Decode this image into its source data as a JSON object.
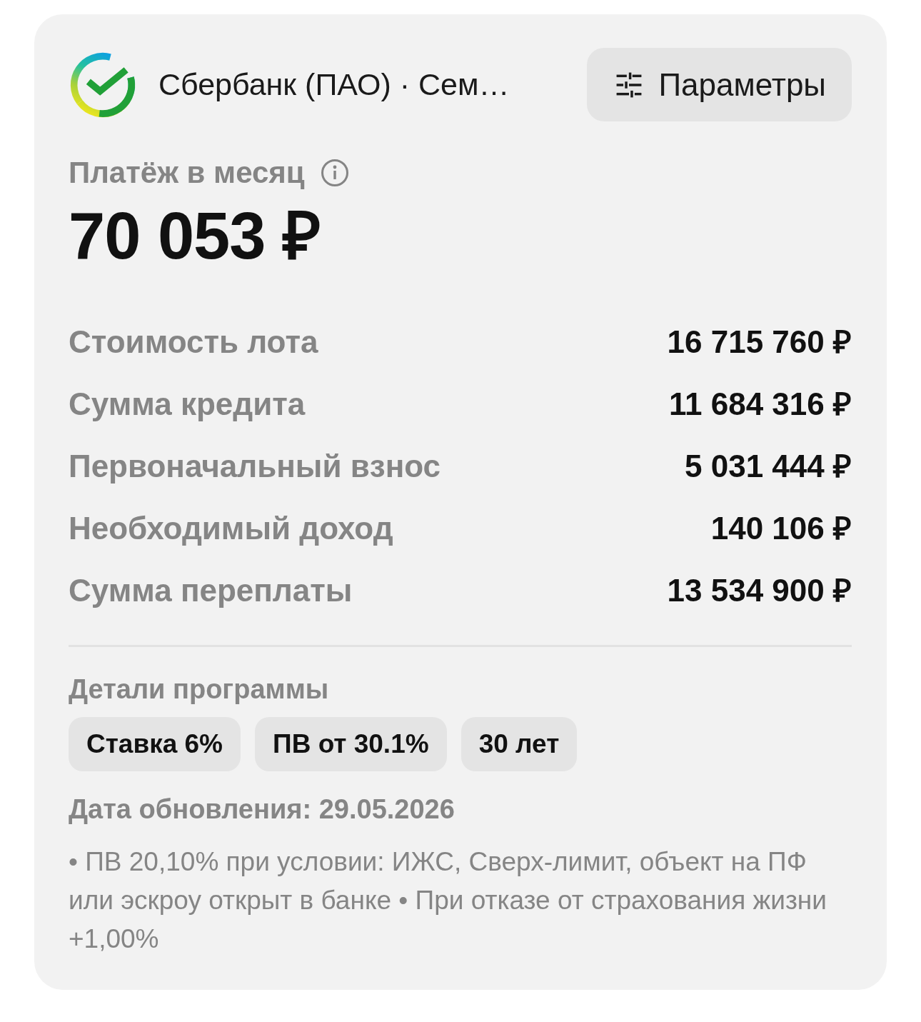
{
  "header": {
    "title": "Сбербанк (ПАО) · Сем…",
    "button": "Параметры"
  },
  "payment": {
    "label": "Платёж в месяц",
    "amount": "70 053 ₽"
  },
  "summary": [
    {
      "label": "Стоимость лота",
      "value": "16 715 760 ₽"
    },
    {
      "label": "Сумма кредита",
      "value": "11 684 316 ₽"
    },
    {
      "label": "Первоначальный взнос",
      "value": "5 031 444 ₽"
    },
    {
      "label": "Необходимый доход",
      "value": "140 106 ₽"
    },
    {
      "label": "Сумма переплаты",
      "value": "13 534 900 ₽"
    }
  ],
  "program": {
    "title": "Детали программы",
    "tags": [
      "Ставка 6%",
      "ПВ от 30.1%",
      "30 лет"
    ],
    "updated": "Дата обновления: 29.05.2026",
    "notes": "• ПВ 20,10% при условии: ИЖС, Сверх-лимит, объект на ПФ или эскроу открыт в банке • При отказе от страхования жизни +1,00%"
  }
}
